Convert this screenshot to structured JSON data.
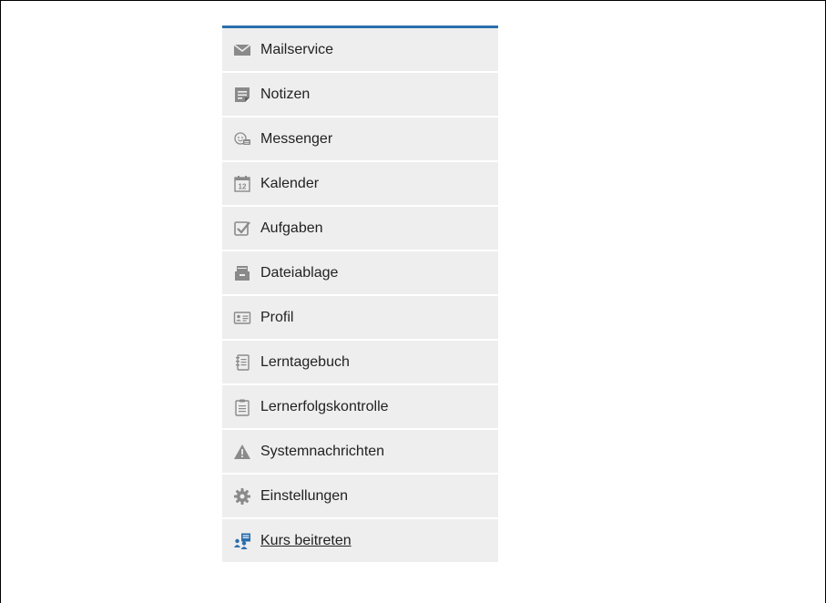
{
  "menu": {
    "items": [
      {
        "label": "Mailservice",
        "icon": "envelope-icon"
      },
      {
        "label": "Notizen",
        "icon": "note-icon"
      },
      {
        "label": "Messenger",
        "icon": "chat-icon"
      },
      {
        "label": "Kalender",
        "icon": "calendar-icon"
      },
      {
        "label": "Aufgaben",
        "icon": "checkbox-icon"
      },
      {
        "label": "Dateiablage",
        "icon": "file-cabinet-icon"
      },
      {
        "label": "Profil",
        "icon": "id-card-icon"
      },
      {
        "label": "Lerntagebuch",
        "icon": "notebook-icon"
      },
      {
        "label": "Lernerfolgskontrolle",
        "icon": "clipboard-icon"
      },
      {
        "label": "Systemnachrichten",
        "icon": "warning-icon"
      },
      {
        "label": "Einstellungen",
        "icon": "gear-icon"
      },
      {
        "label": "Kurs beitreten",
        "icon": "join-course-icon"
      }
    ],
    "calendar_icon_day": "12"
  },
  "colors": {
    "accent": "#2a6fad",
    "item_background": "#eeeeee",
    "icon_gray": "#8a8a8a",
    "join_icon_blue": "#2a6fad"
  }
}
